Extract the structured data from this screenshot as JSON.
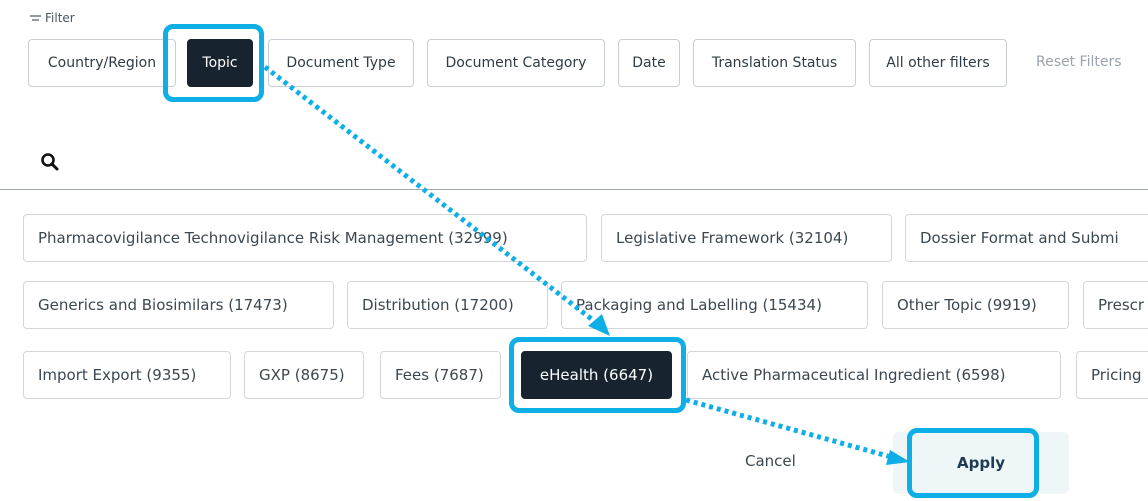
{
  "filter_bar": {
    "label": "Filter",
    "chips": [
      {
        "label": "Country/Region"
      },
      {
        "label": "Topic"
      },
      {
        "label": "Document Type"
      },
      {
        "label": "Document Category"
      },
      {
        "label": "Date"
      },
      {
        "label": "Translation Status"
      },
      {
        "label": "All other filters"
      }
    ],
    "active_chip": "Topic",
    "reset_label": "Reset Filters"
  },
  "search": {
    "placeholder": "",
    "value": ""
  },
  "topics": [
    {
      "label": "Pharmacovigilance Technovigilance Risk Management (32999)"
    },
    {
      "label": "Legislative Framework (32104)"
    },
    {
      "label": "Dossier Format and Submi"
    },
    {
      "label": "Generics and Biosimilars (17473)"
    },
    {
      "label": "Distribution (17200)"
    },
    {
      "label": "Packaging and Labelling (15434)"
    },
    {
      "label": "Other Topic (9919)"
    },
    {
      "label": "Prescr"
    },
    {
      "label": "Import Export (9355)"
    },
    {
      "label": "GXP (8675)"
    },
    {
      "label": "Fees (7687)"
    },
    {
      "label": "eHealth (6647)"
    },
    {
      "label": "Active Pharmaceutical Ingredient (6598)"
    },
    {
      "label": "Pricing"
    }
  ],
  "selected_topic": "eHealth (6647)",
  "actions": {
    "cancel_label": "Cancel",
    "apply_label": "Apply"
  },
  "colors": {
    "highlight": "#0eaee6",
    "active_bg": "#17242f",
    "apply_bg": "#eef6f8"
  }
}
